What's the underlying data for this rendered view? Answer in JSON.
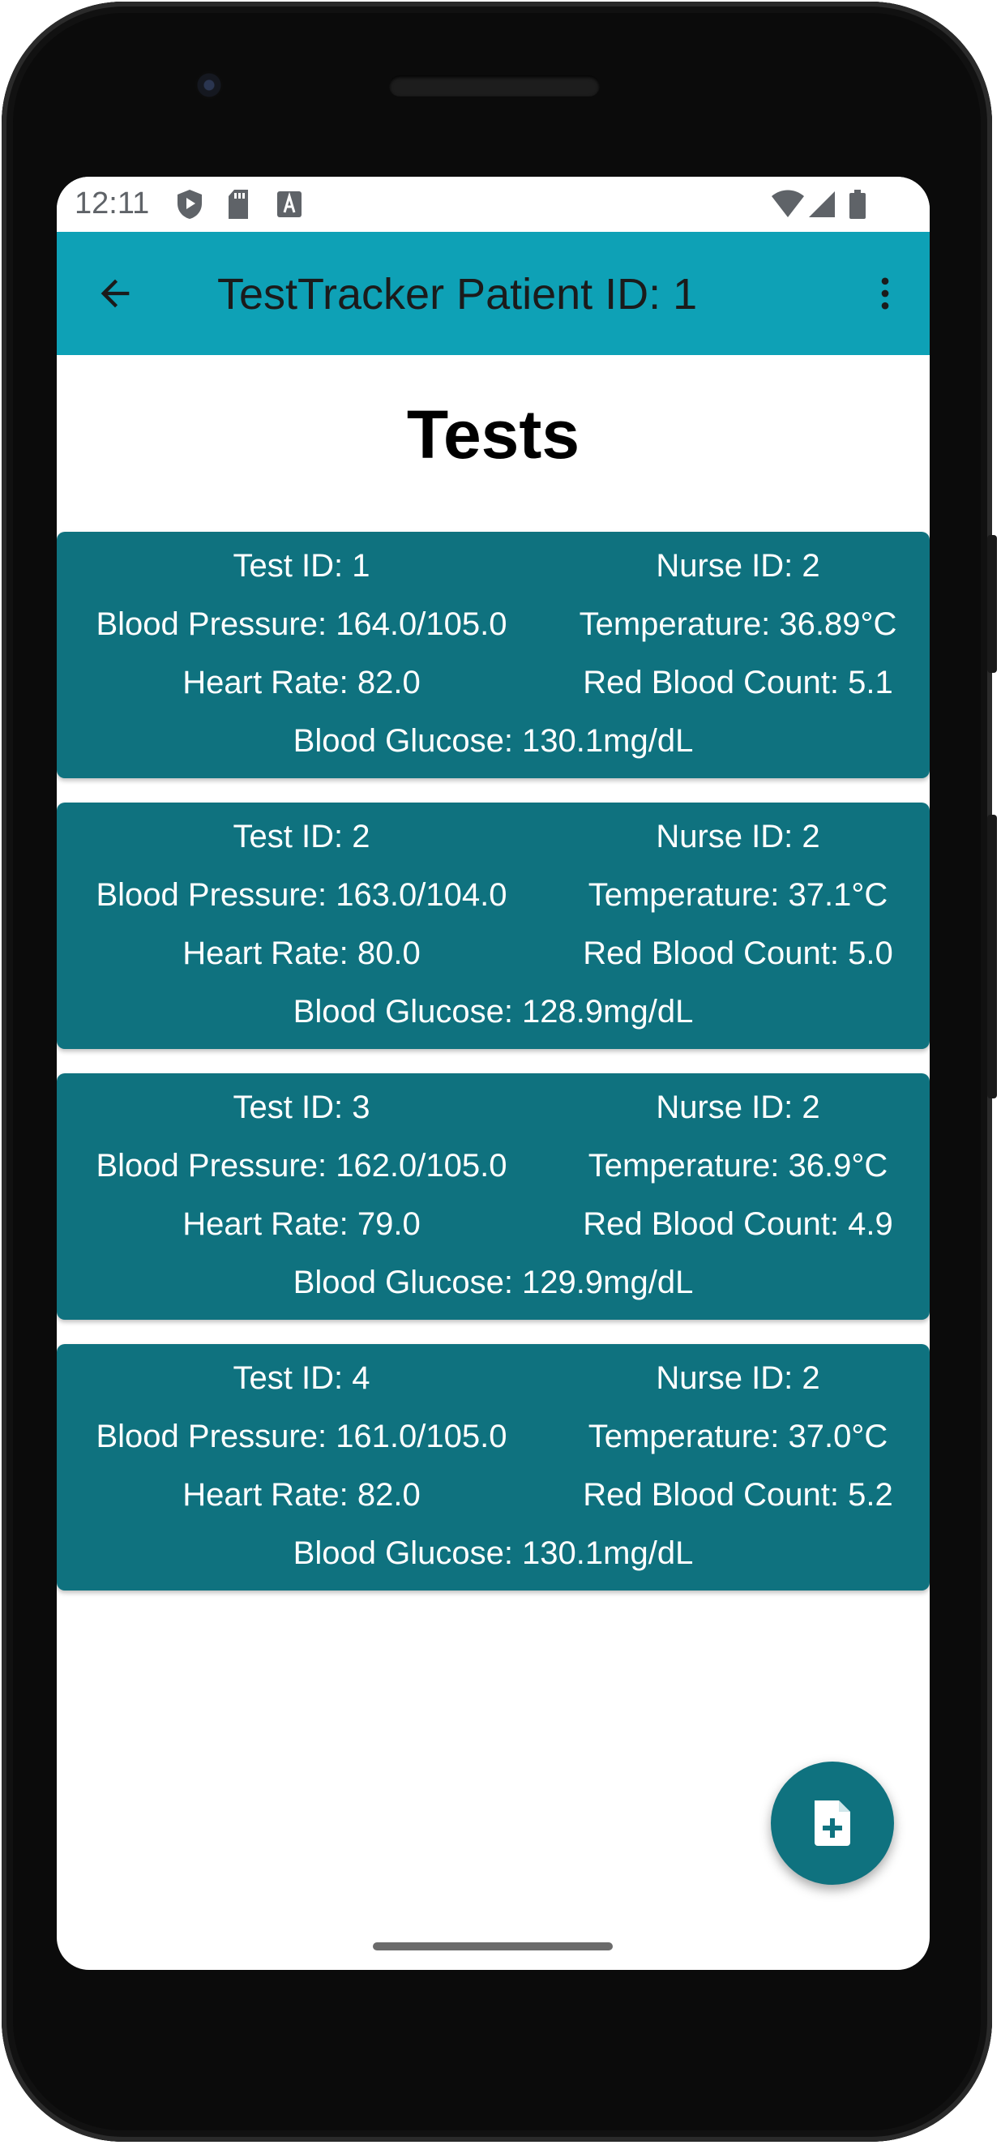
{
  "status_bar": {
    "time": "12:11",
    "left_icons": [
      "shield-play-icon",
      "sd-card-icon",
      "text-a-icon"
    ],
    "right_icons": [
      "wifi-icon",
      "signal-icon",
      "battery-icon"
    ]
  },
  "app_bar": {
    "title": "TestTracker Patient ID: 1",
    "back_icon": "arrow-back-icon",
    "menu_icon": "more-vert-icon",
    "color": "#0ea1b6"
  },
  "page": {
    "heading": "Tests"
  },
  "tests": [
    {
      "test_id": "Test ID: 1",
      "nurse_id": "Nurse ID: 2",
      "blood_pressure": "Blood Pressure: 164.0/105.0",
      "temperature": "Temperature: 36.89°C",
      "heart_rate": "Heart Rate: 82.0",
      "red_blood_count": "Red Blood Count: 5.1",
      "blood_glucose": "Blood Glucose: 130.1mg/dL"
    },
    {
      "test_id": "Test ID: 2",
      "nurse_id": "Nurse ID: 2",
      "blood_pressure": "Blood Pressure: 163.0/104.0",
      "temperature": "Temperature: 37.1°C",
      "heart_rate": "Heart Rate: 80.0",
      "red_blood_count": "Red Blood Count: 5.0",
      "blood_glucose": "Blood Glucose: 128.9mg/dL"
    },
    {
      "test_id": "Test ID: 3",
      "nurse_id": "Nurse ID: 2",
      "blood_pressure": "Blood Pressure: 162.0/105.0",
      "temperature": "Temperature: 36.9°C",
      "heart_rate": "Heart Rate: 79.0",
      "red_blood_count": "Red Blood Count: 4.9",
      "blood_glucose": "Blood Glucose: 129.9mg/dL"
    },
    {
      "test_id": "Test ID: 4",
      "nurse_id": "Nurse ID: 2",
      "blood_pressure": "Blood Pressure: 161.0/105.0",
      "temperature": "Temperature: 37.0°C",
      "heart_rate": "Heart Rate: 82.0",
      "red_blood_count": "Red Blood Count: 5.2",
      "blood_glucose": "Blood Glucose: 130.1mg/dL"
    }
  ],
  "fab": {
    "icon": "add-document-icon",
    "color": "#0f727f"
  },
  "colors": {
    "card_background": "#0f727f",
    "card_text": "#ffffff"
  }
}
